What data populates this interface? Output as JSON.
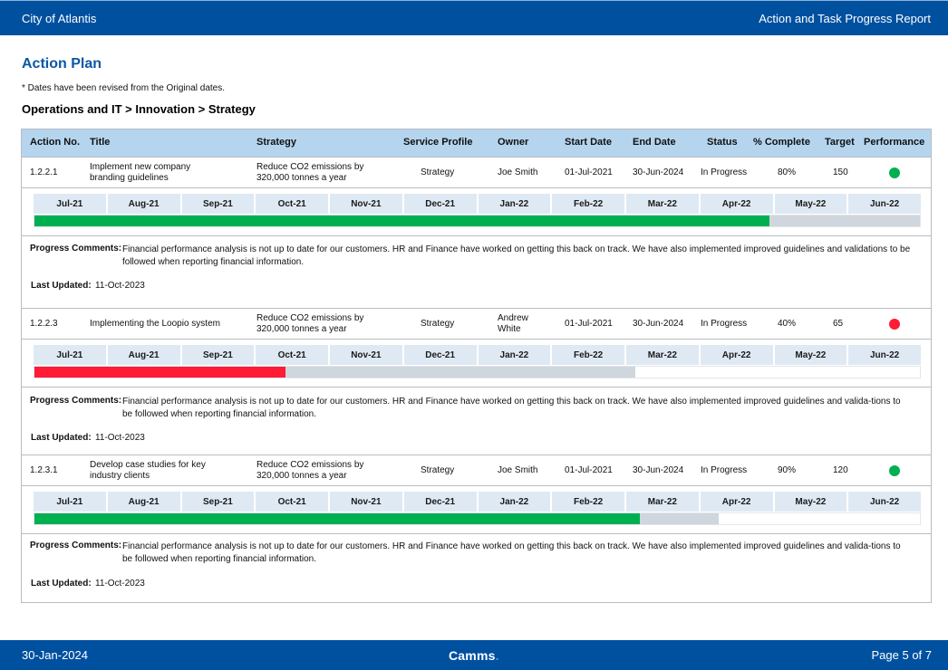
{
  "header": {
    "organization": "City of Atlantis",
    "report_title": "Action and Task Progress Report"
  },
  "page": {
    "title": "Action Plan",
    "note": "* Dates have been revised from the Original dates.",
    "breadcrumb": "Operations and IT > Innovation > Strategy"
  },
  "table": {
    "columns": [
      "Action No.",
      "Title",
      "Strategy",
      "Service Profile",
      "Owner",
      "Start Date",
      "End Date",
      "Status",
      "% Complete",
      "Target",
      "Performance"
    ],
    "months": [
      "Jul-21",
      "Aug-21",
      "Sep-21",
      "Oct-21",
      "Nov-21",
      "Dec-21",
      "Jan-22",
      "Feb-22",
      "Mar-22",
      "Apr-22",
      "May-22",
      "Jun-22"
    ],
    "comments_label": "Progress Comments:",
    "updated_label": "Last Updated:",
    "rows": [
      {
        "action_no": "1.2.2.1",
        "title": "Implement new company branding guidelines",
        "strategy": "Reduce CO2 emissions by 320,000 tonnes a year",
        "service_profile": "Strategy",
        "owner": "Joe Smith",
        "start_date": "01-Jul-2021",
        "end_date": "30-Jun-2024",
        "status": "In Progress",
        "percent_complete": "80%",
        "target": "150",
        "performance": "on-track",
        "performance_color": "#00b050",
        "gantt_actual_fraction": 0.83,
        "gantt_planned_fraction": 1.0,
        "gantt_actual_color": "#00b050",
        "comments": "Financial performance analysis is not up to date for our customers. HR and Finance have worked on getting this back on track. We have also implemented improved guidelines and validations to be followed when reporting financial information.",
        "last_updated": "11-Oct-2023"
      },
      {
        "action_no": "1.2.2.3",
        "title": "Implementing the Loopio system",
        "strategy": "Reduce CO2 emissions by 320,000 tonnes a year",
        "service_profile": "Strategy",
        "owner": "Andrew White",
        "start_date": "01-Jul-2021",
        "end_date": "30-Jun-2024",
        "status": "In Progress",
        "percent_complete": "40%",
        "target": "65",
        "performance": "off-track",
        "performance_color": "#ff1a35",
        "gantt_actual_fraction": 0.284,
        "gantt_planned_fraction": 0.679,
        "gantt_actual_color": "#ff1a35",
        "comments": "Financial performance analysis is not up to date for our customers. HR and Finance have worked on getting this back on track. We have also implemented improved guidelines and valida-tions to be followed when reporting financial information.",
        "last_updated": "11-Oct-2023"
      },
      {
        "action_no": "1.2.3.1",
        "title": "Develop case studies for key industry clients",
        "strategy": "Reduce CO2 emissions by 320,000 tonnes a year",
        "service_profile": "Strategy",
        "owner": "Joe Smith",
        "start_date": "01-Jul-2021",
        "end_date": "30-Jun-2024",
        "status": "In Progress",
        "percent_complete": "90%",
        "target": "120",
        "performance": "on-track",
        "performance_color": "#00b050",
        "gantt_actual_fraction": 0.684,
        "gantt_planned_fraction": 0.773,
        "gantt_actual_color": "#00b050",
        "comments": "Financial performance analysis is not up to date for our customers. HR and Finance have worked on getting this back on track. We have also implemented improved guidelines and valida-tions to be followed when reporting financial information.",
        "last_updated": "11-Oct-2023"
      }
    ]
  },
  "footer": {
    "date": "30-Jan-2024",
    "logo_text": "Camms",
    "logo_dot": ".",
    "page_indicator": "Page 5 of 7"
  }
}
